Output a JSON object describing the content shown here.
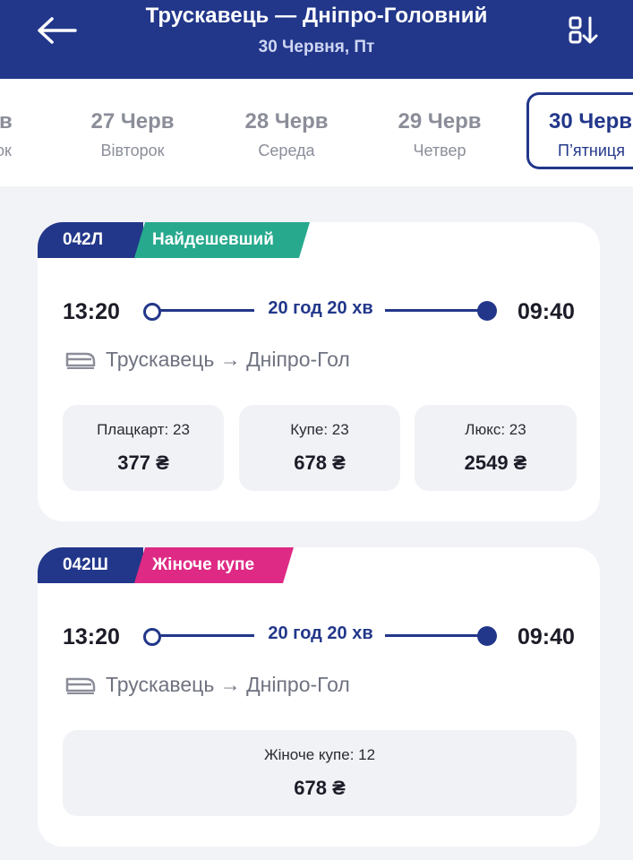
{
  "header": {
    "title": "Трускавець — Дніпро-Головний",
    "subtitle": "30 Червня, Пт",
    "back_icon": "arrow-left-icon",
    "sort_icon": "sort-icon"
  },
  "dates": [
    {
      "day": "ов",
      "weekday": "нок"
    },
    {
      "day": "27 Черв",
      "weekday": "Вівторок"
    },
    {
      "day": "28 Черв",
      "weekday": "Середа"
    },
    {
      "day": "29 Черв",
      "weekday": "Четвер"
    },
    {
      "day": "30 Черв",
      "weekday": "П’ятниця",
      "selected": true
    }
  ],
  "trains": [
    {
      "number": "042Л",
      "tag": "Найдешевший",
      "tag_color": "#27a98d",
      "departure": "13:20",
      "duration": "20 год 20 хв",
      "arrival": "09:40",
      "route": "Трускавець → Дніпро-Гол",
      "fares": [
        {
          "label": "Плацкарт: 23",
          "price": "377 ₴"
        },
        {
          "label": "Купе: 23",
          "price": "678 ₴"
        },
        {
          "label": "Люкс: 23",
          "price": "2549 ₴"
        }
      ]
    },
    {
      "number": "042Ш",
      "tag": "Жіноче купе",
      "tag_color": "#de2a85",
      "departure": "13:20",
      "duration": "20 год 20 хв",
      "arrival": "09:40",
      "route": "Трускавець → Дніпро-Гол",
      "fares": [
        {
          "label": "Жіноче купе: 12",
          "price": "678 ₴"
        }
      ]
    }
  ],
  "colors": {
    "primary": "#22378a",
    "background": "#f2f3f7"
  }
}
